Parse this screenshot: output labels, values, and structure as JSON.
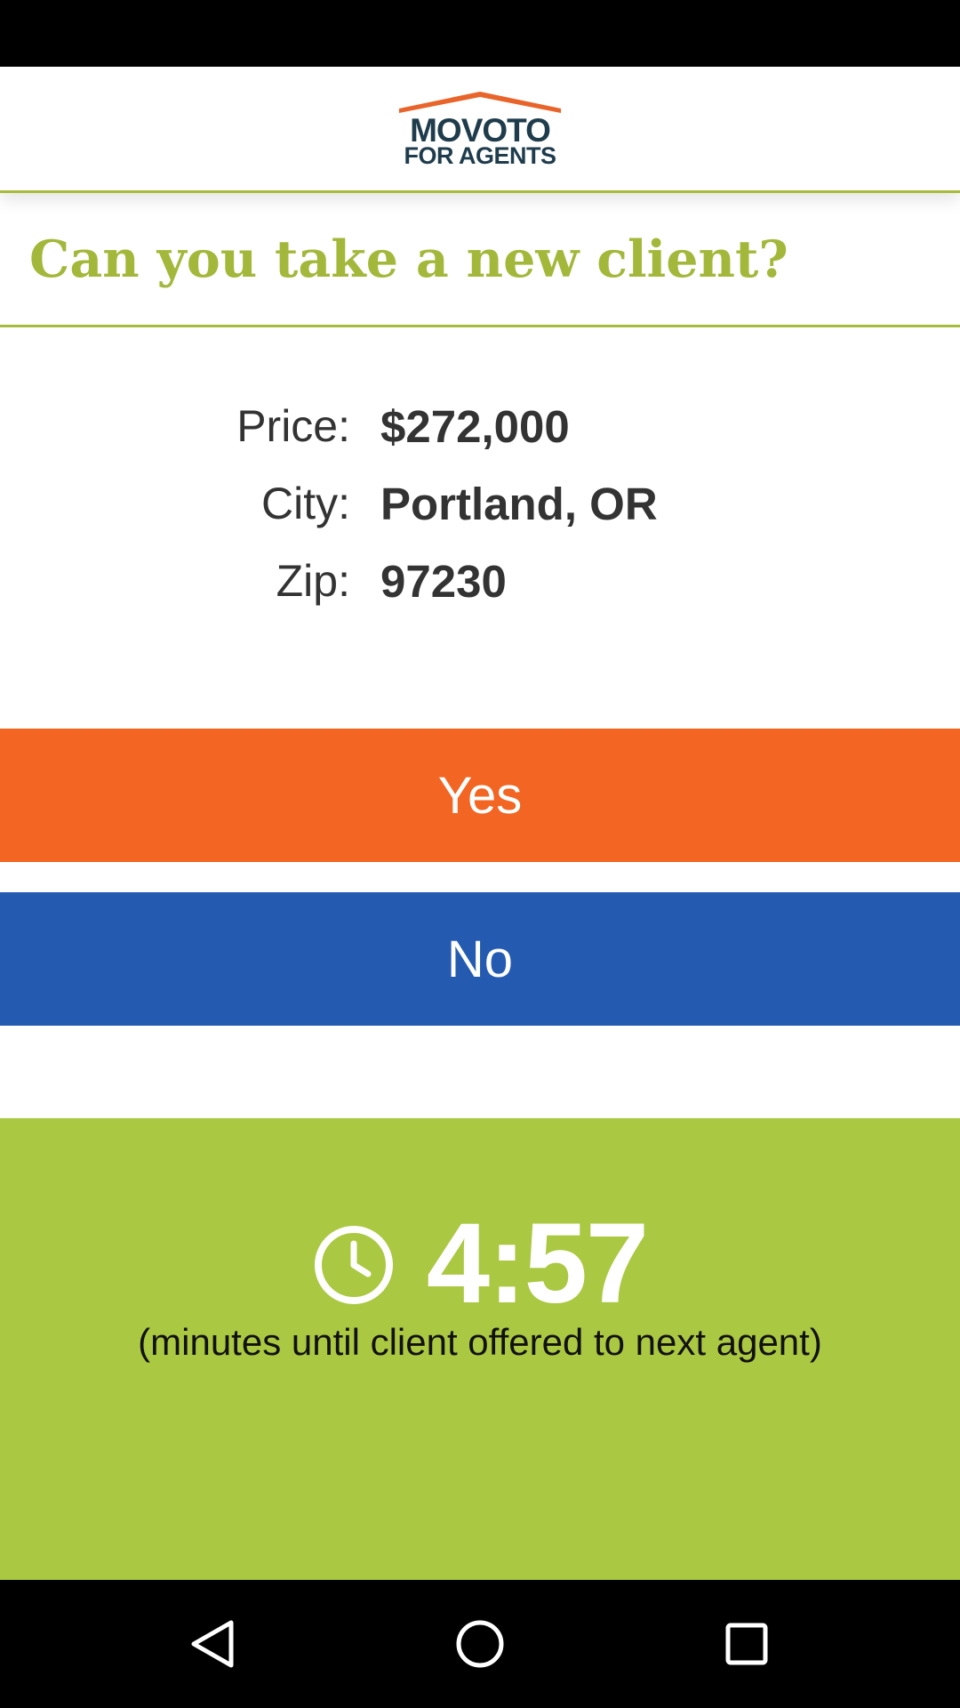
{
  "header": {
    "logo_line1": "MOVOTO",
    "logo_line2": "FOR AGENTS",
    "roof_color": "#e8642a",
    "logo_text_color": "#1f3c4c"
  },
  "question": {
    "title": "Can you take a new client?"
  },
  "details": {
    "price": {
      "label": "Price:",
      "value": "$272,000"
    },
    "city": {
      "label": "City:",
      "value": "Portland, OR"
    },
    "zip": {
      "label": "Zip:",
      "value": "97230"
    }
  },
  "actions": {
    "yes_label": "Yes",
    "no_label": "No",
    "yes_color": "#f26522",
    "no_color": "#245bb1"
  },
  "timer": {
    "value": "4:57",
    "caption": "(minutes until client offered to next agent)",
    "icon": "clock-icon",
    "panel_color": "#abc842"
  },
  "navigation": {
    "back_icon": "back-triangle-icon",
    "home_icon": "home-circle-icon",
    "recents_icon": "recents-square-icon"
  }
}
